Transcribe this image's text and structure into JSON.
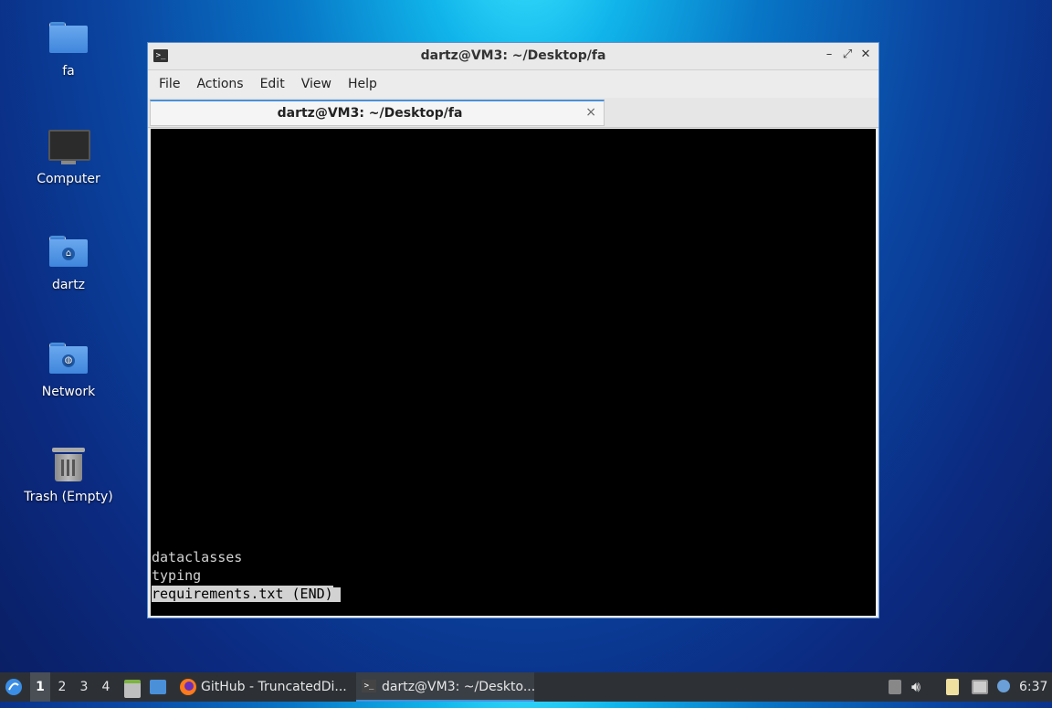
{
  "desktop": {
    "icons": [
      {
        "label": "fa",
        "icon": "folder-icon"
      },
      {
        "label": "Computer",
        "icon": "computer-icon"
      },
      {
        "label": "dartz",
        "icon": "home-folder-icon"
      },
      {
        "label": "Network",
        "icon": "network-folder-icon"
      },
      {
        "label": "Trash (Empty)",
        "icon": "trash-icon"
      }
    ]
  },
  "window": {
    "title": "dartz@VM3: ~/Desktop/fa",
    "controls": {
      "minimize": "–",
      "maximize": "⤢",
      "close": "✕"
    },
    "menu": [
      "File",
      "Actions",
      "Edit",
      "View",
      "Help"
    ],
    "tab": {
      "label": "dartz@VM3: ~/Desktop/fa",
      "close": "×"
    },
    "terminal": {
      "lines": [
        "dataclasses",
        "typing"
      ],
      "status": "requirements.txt (END)"
    }
  },
  "taskbar": {
    "workspaces": [
      "1",
      "2",
      "3",
      "4"
    ],
    "active_workspace": "1",
    "tasks": [
      {
        "label": "GitHub - TruncatedDi...",
        "icon": "firefox-icon"
      },
      {
        "label": "dartz@VM3: ~/Deskto...",
        "icon": "terminal-icon"
      }
    ],
    "clock": "6:37"
  },
  "colors": {
    "accent": "#4a90d9",
    "terminal_bg": "#000000",
    "terminal_fg": "#d2d2d2"
  }
}
